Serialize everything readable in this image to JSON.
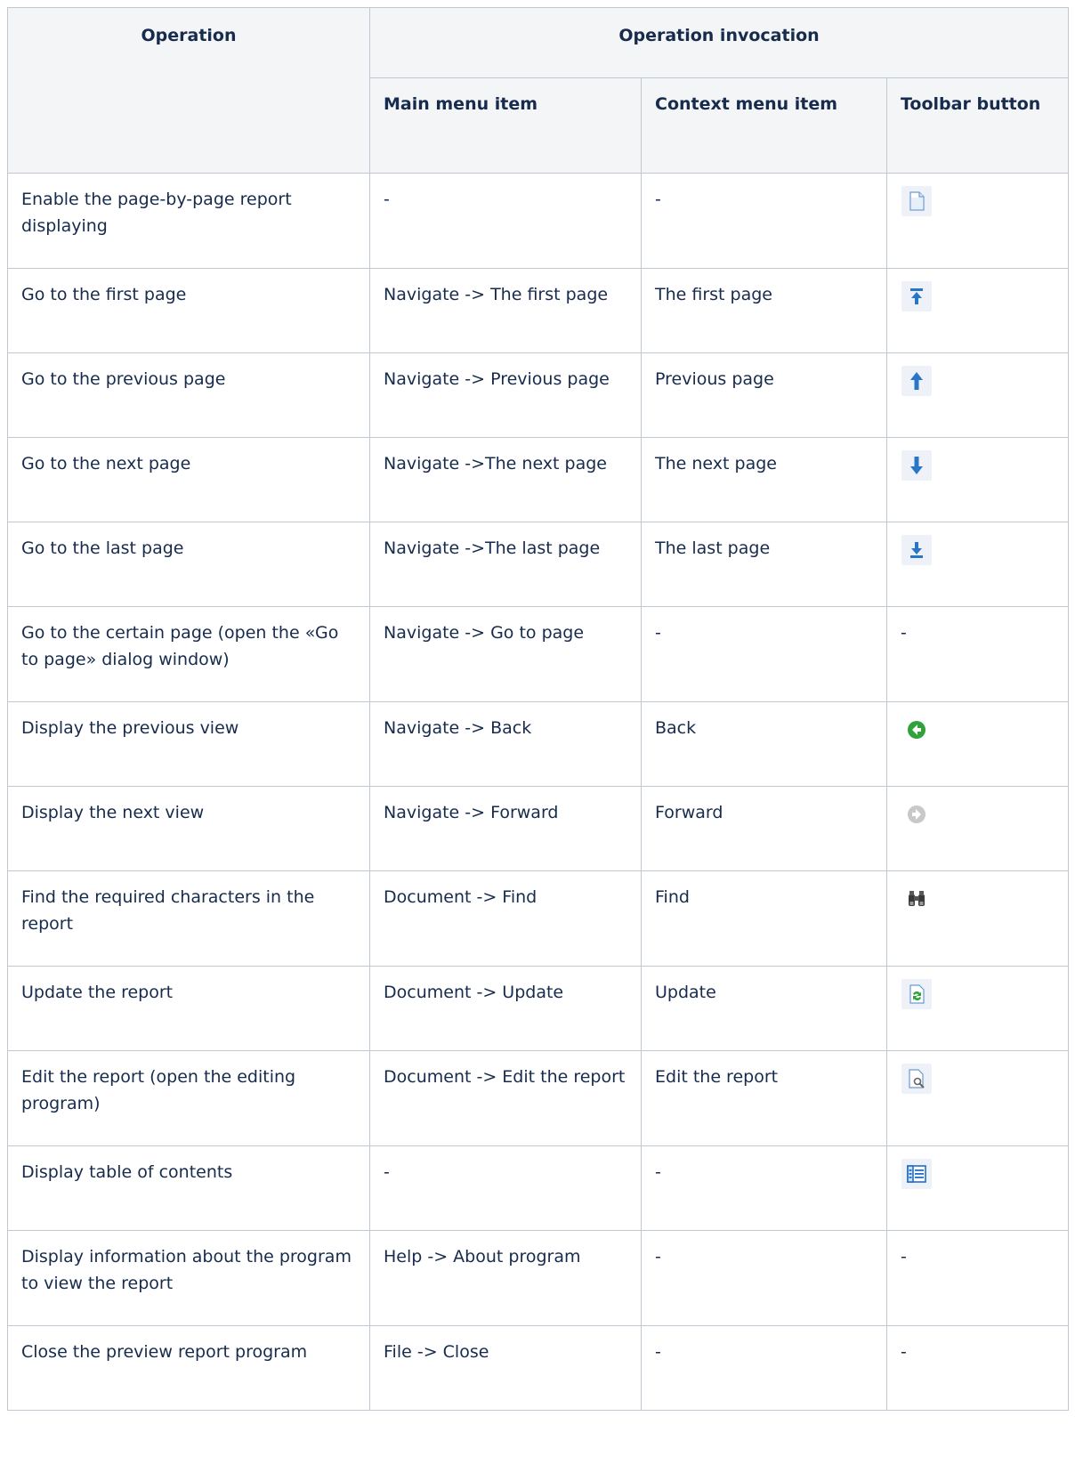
{
  "table": {
    "headers": {
      "operation": "Operation",
      "operation_invocation": "Operation invocation",
      "main_menu_item": "Main menu item",
      "context_menu_item": "Context menu item",
      "toolbar_button": "Toolbar button"
    },
    "rows": [
      {
        "operation": "Enable the page-by-page report displaying",
        "main": "-",
        "context": "-",
        "toolbar": "",
        "icon": "page-icon"
      },
      {
        "operation": "Go to the first page",
        "main": "Navigate -> The first page",
        "context": "The first page",
        "toolbar": "",
        "icon": "first-page-icon"
      },
      {
        "operation": "Go to the previous page",
        "main": "Navigate -> Previous page",
        "context": "Previous page",
        "toolbar": "",
        "icon": "arrow-up-icon"
      },
      {
        "operation": "Go to the next page",
        "main": "Navigate ->The next page",
        "context": "The next page",
        "toolbar": "",
        "icon": "arrow-down-icon"
      },
      {
        "operation": "Go to the last page",
        "main": "Navigate ->The last page",
        "context": "The last page",
        "toolbar": "",
        "icon": "last-page-icon"
      },
      {
        "operation": "Go to the certain page (open the «Go to page» dialog window)",
        "main": "Navigate -> Go to page",
        "context": "-",
        "toolbar": "-",
        "icon": ""
      },
      {
        "operation": "Display the previous view",
        "main": "Navigate -> Back",
        "context": "Back",
        "toolbar": "",
        "icon": "back-icon"
      },
      {
        "operation": "Display the next view",
        "main": "Navigate -> Forward",
        "context": "Forward",
        "toolbar": "",
        "icon": "forward-icon"
      },
      {
        "operation": "Find the required characters in the report",
        "main": "Document -> Find",
        "context": "Find",
        "toolbar": "",
        "icon": "binoculars-icon"
      },
      {
        "operation": "Update the report",
        "main": "Document -> Update",
        "context": "Update",
        "toolbar": "",
        "icon": "refresh-icon"
      },
      {
        "operation": "Edit the report (open the editing program)",
        "main": "Document -> Edit the report",
        "context": "Edit the report",
        "toolbar": "",
        "icon": "edit-report-icon"
      },
      {
        "operation": "Display table of contents",
        "main": "-",
        "context": "-",
        "toolbar": "",
        "icon": "table-of-contents-icon"
      },
      {
        "operation": "Display information about the program to view the report",
        "main": "Help -> About program",
        "context": "-",
        "toolbar": "-",
        "icon": ""
      },
      {
        "operation": "Close the preview report program",
        "main": "File -> Close",
        "context": "-",
        "toolbar": "-",
        "icon": ""
      }
    ]
  }
}
